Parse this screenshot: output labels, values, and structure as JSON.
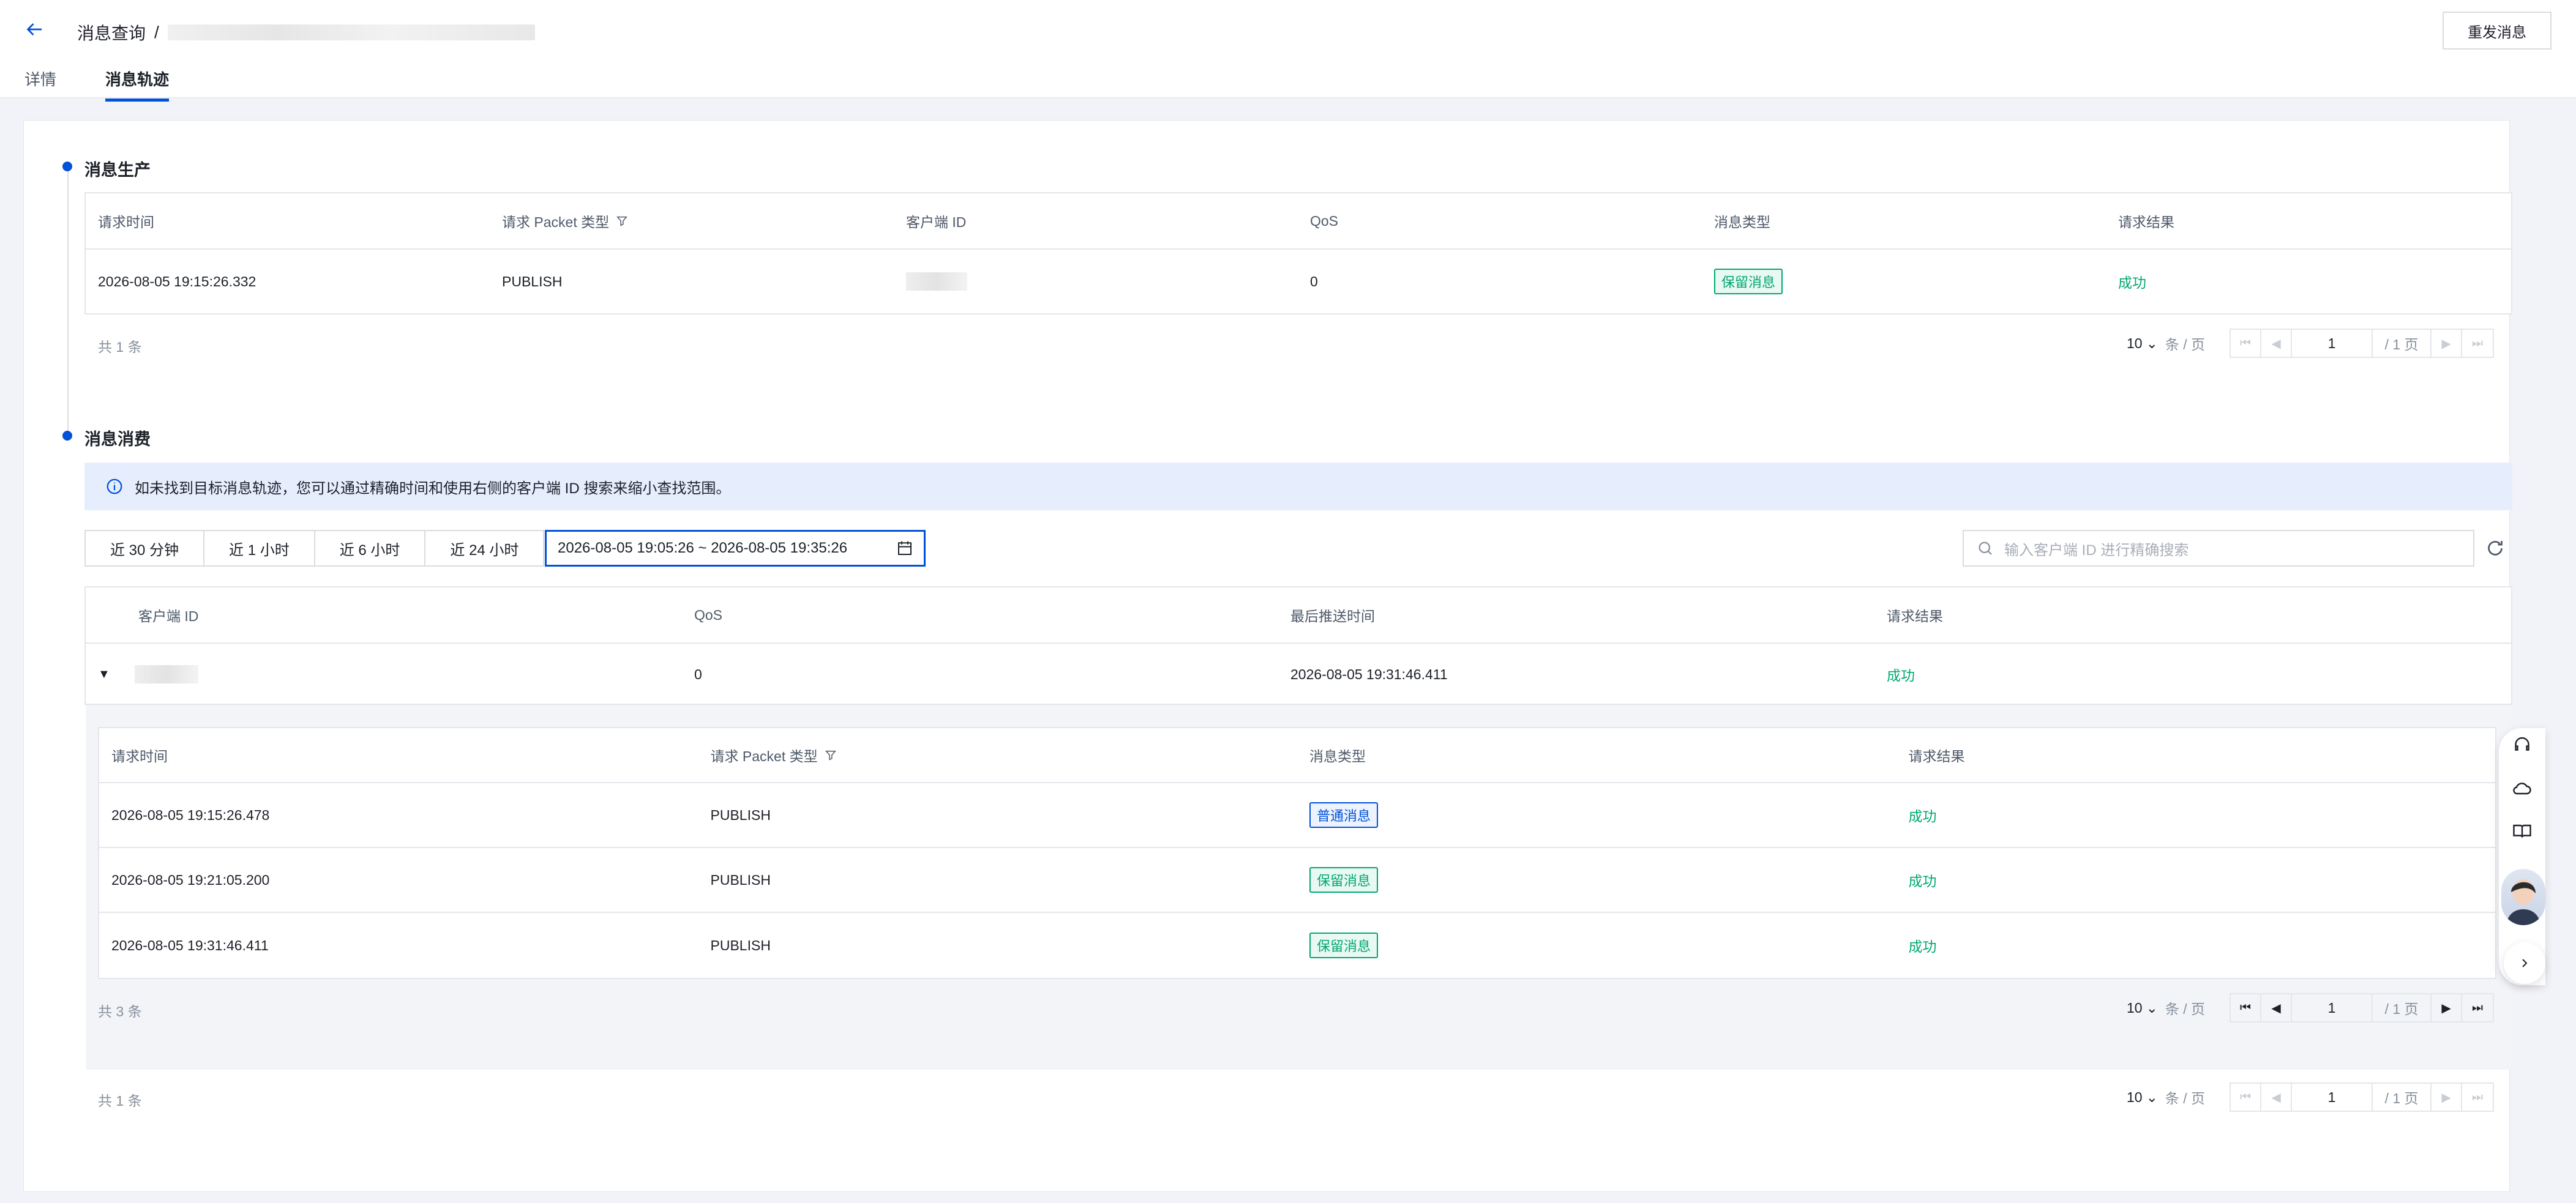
{
  "header": {
    "breadcrumb_label": "消息查询",
    "breadcrumb_sep": "/",
    "resend_label": "重发消息"
  },
  "tabs": [
    {
      "label": "详情",
      "active": false
    },
    {
      "label": "消息轨迹",
      "active": true
    }
  ],
  "production": {
    "title": "消息生产",
    "columns": [
      "请求时间",
      "请求 Packet 类型",
      "客户端 ID",
      "QoS",
      "消息类型",
      "请求结果"
    ],
    "row": {
      "time": "2026-08-05 19:15:26.332",
      "packet": "PUBLISH",
      "qos": "0",
      "msg_type": "保留消息",
      "result": "成功"
    },
    "total": "共 1 条",
    "pager": {
      "size": "10",
      "unit": "条 / 页",
      "page": "1",
      "pages": "/ 1 页"
    }
  },
  "consumption": {
    "title": "消息消费",
    "notice": "如未找到目标消息轨迹，您可以通过精确时间和使用右侧的客户端 ID 搜索来缩小查找范围。",
    "ranges": [
      "近 30 分钟",
      "近 1 小时",
      "近 6 小时",
      "近 24 小时"
    ],
    "date_range": "2026-08-05 19:05:26 ~ 2026-08-05 19:35:26",
    "search_placeholder": "输入客户端 ID 进行精确搜索",
    "columns": [
      "客户端 ID",
      "QoS",
      "最后推送时间",
      "请求结果"
    ],
    "row": {
      "qos": "0",
      "last_push": "2026-08-05 19:31:46.411",
      "result": "成功"
    },
    "inner_columns": [
      "请求时间",
      "请求 Packet 类型",
      "消息类型",
      "请求结果"
    ],
    "inner_rows": [
      {
        "time": "2026-08-05 19:15:26.478",
        "packet": "PUBLISH",
        "msg_type": "普通消息",
        "tag": "blue",
        "result": "成功"
      },
      {
        "time": "2026-08-05 19:21:05.200",
        "packet": "PUBLISH",
        "msg_type": "保留消息",
        "tag": "green",
        "result": "成功"
      },
      {
        "time": "2026-08-05 19:31:46.411",
        "packet": "PUBLISH",
        "msg_type": "保留消息",
        "tag": "green",
        "result": "成功"
      }
    ],
    "inner_total": "共 3 条",
    "inner_pager": {
      "size": "10",
      "unit": "条 / 页",
      "page": "1",
      "pages": "/ 1 页"
    },
    "total": "共 1 条",
    "pager": {
      "size": "10",
      "unit": "条 / 页",
      "page": "1",
      "pages": "/ 1 页"
    }
  },
  "colors": {
    "accent": "#0052d9",
    "success": "#00a870",
    "notice_bg": "#e6eefe"
  }
}
